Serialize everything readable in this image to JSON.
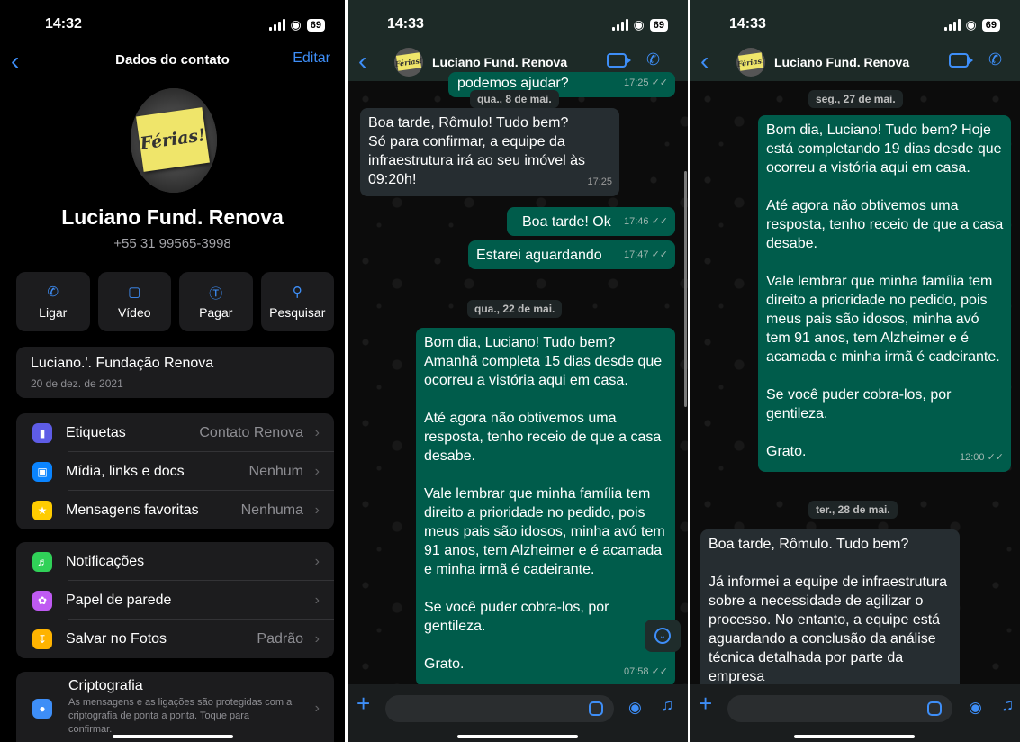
{
  "contact_panel": {
    "time": "14:32",
    "battery": "69",
    "title": "Dados do contato",
    "edit": "Editar",
    "avatar_text": "Férias!",
    "name": "Luciano Fund. Renova",
    "phone": "+55 31 99565-3998",
    "actions": [
      {
        "label": "Ligar",
        "icon": "phone-icon"
      },
      {
        "label": "Vídeo",
        "icon": "video-icon"
      },
      {
        "label": "Pagar",
        "icon": "pay-icon"
      },
      {
        "label": "Pesquisar",
        "icon": "search-icon"
      }
    ],
    "about": {
      "text": "Luciano.'. Fundação Renova",
      "date": "20 de dez. de 2021"
    },
    "list1": [
      {
        "label": "Etiquetas",
        "value": "Contato Renova",
        "color": "#5e5ce6"
      },
      {
        "label": "Mídia, links e docs",
        "value": "Nenhum",
        "color": "#0a84ff"
      },
      {
        "label": "Mensagens favoritas",
        "value": "Nenhuma",
        "color": "#ffcc00"
      }
    ],
    "list2": [
      {
        "label": "Notificações",
        "value": "",
        "color": "#30d158"
      },
      {
        "label": "Papel de parede",
        "value": "",
        "color": "#bf5af2"
      },
      {
        "label": "Salvar no Fotos",
        "value": "Padrão",
        "color": "#ffb300"
      }
    ],
    "crypto": {
      "title": "Criptografia",
      "desc": "As mensagens e as ligações são protegidas com a criptografia de ponta a ponta. Toque para confirmar."
    }
  },
  "chat_panel_1": {
    "time": "14:33",
    "battery": "69",
    "contact_name": "Luciano Fund. Renova",
    "avatar_text": "Férias!",
    "partial_msg": {
      "text": "podemos ajudar?",
      "time": "17:25"
    },
    "date1": "qua., 8 de mai.",
    "msg_in_1": {
      "text": "Boa tarde, Rômulo! Tudo bem?\nSó para confirmar, a equipe da infraestrutura irá ao seu imóvel às 09:20h!",
      "time": "17:25"
    },
    "msg_out_1": {
      "text": "Boa tarde! Ok",
      "time": "17:46"
    },
    "msg_out_2": {
      "text": "Estarei aguardando",
      "time": "17:47"
    },
    "date2": "qua., 22 de mai.",
    "msg_out_3": {
      "text": "Bom dia, Luciano! Tudo bem?\nAmanhã completa 15 dias desde que ocorreu a vistória aqui em casa.\n\nAté agora não obtivemos uma resposta, tenho receio de que a casa desabe.\n\nVale lembrar que minha família tem direito a prioridade no pedido, pois meus pais são idosos, minha avó tem 91 anos, tem Alzheimer e é acamada e minha irmã é cadeirante.\n\nSe você puder cobra-los, por gentileza.\n\nGrato.",
      "time": "07:58"
    }
  },
  "chat_panel_2": {
    "time": "14:33",
    "battery": "69",
    "contact_name": "Luciano Fund. Renova",
    "avatar_text": "Férias!",
    "date1": "seg., 27 de mai.",
    "msg_out_1": {
      "text": "Bom dia, Luciano! Tudo bem? Hoje está completando 19 dias desde que ocorreu a vistória aqui em casa.\n\nAté agora não obtivemos uma resposta, tenho receio de que a casa desabe.\n\nVale lembrar que minha família tem direito a prioridade no pedido, pois meus pais são idosos, minha avó tem 91 anos, tem Alzheimer e é acamada e minha irmã é cadeirante.\n\nSe você puder cobra-los, por gentileza.\n\nGrato.",
      "time": "12:00"
    },
    "date2": "ter., 28 de mai.",
    "msg_in_1": {
      "text": "Boa tarde, Rômulo. Tudo bem?\n\nJá informei a equipe de infraestrutura sobre a necessidade de agilizar o processo. No entanto, a equipe está aguardando a conclusão da análise técnica detalhada por parte da empresa"
    }
  }
}
